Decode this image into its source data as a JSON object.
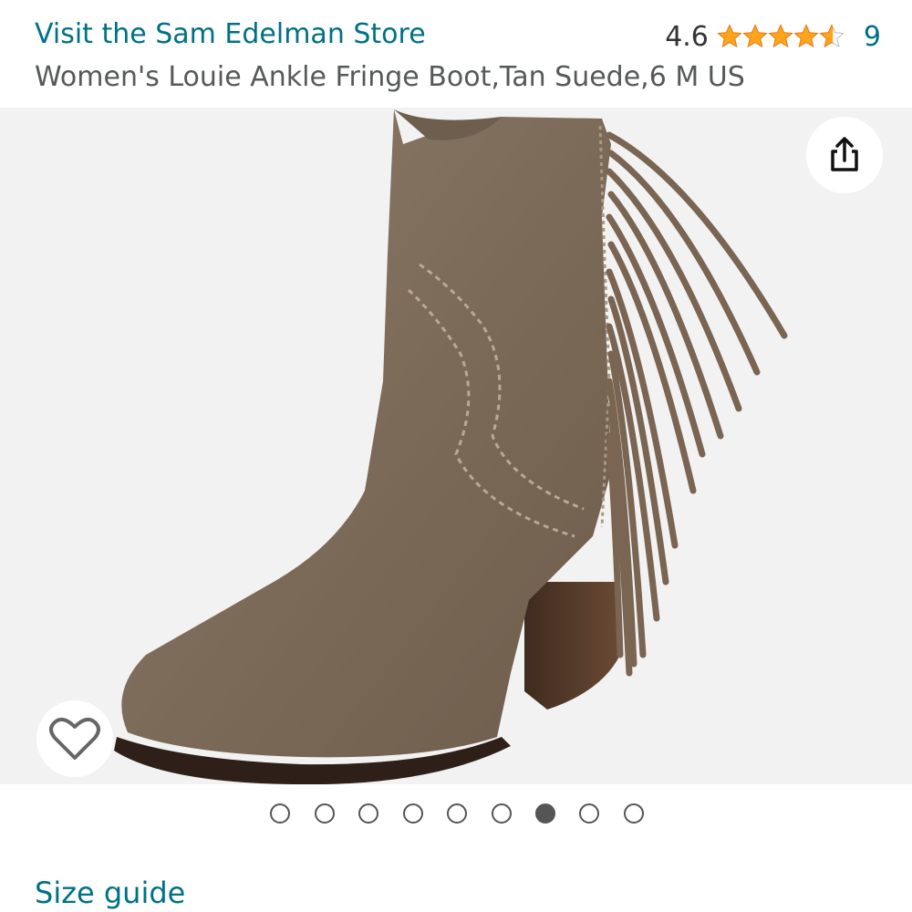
{
  "header": {
    "store_link": "Visit the Sam Edelman Store",
    "rating_value": "4.6",
    "rating_count": "9",
    "product_title": "Women's Louie Ankle Fringe Boot,Tan Suede,6 M US"
  },
  "rating": {
    "stars": 4.6,
    "max": 5,
    "star_color": "#FFA41C"
  },
  "gallery": {
    "image_description": "tan suede fringe ankle boot",
    "total_images": 9,
    "active_index": 7
  },
  "actions": {
    "share_icon": "share-icon",
    "wishlist_icon": "heart-icon"
  },
  "links": {
    "size_guide": "Size guide"
  },
  "colors": {
    "link": "#007185",
    "text": "#565959",
    "image_bg": "#f2f2f2"
  }
}
